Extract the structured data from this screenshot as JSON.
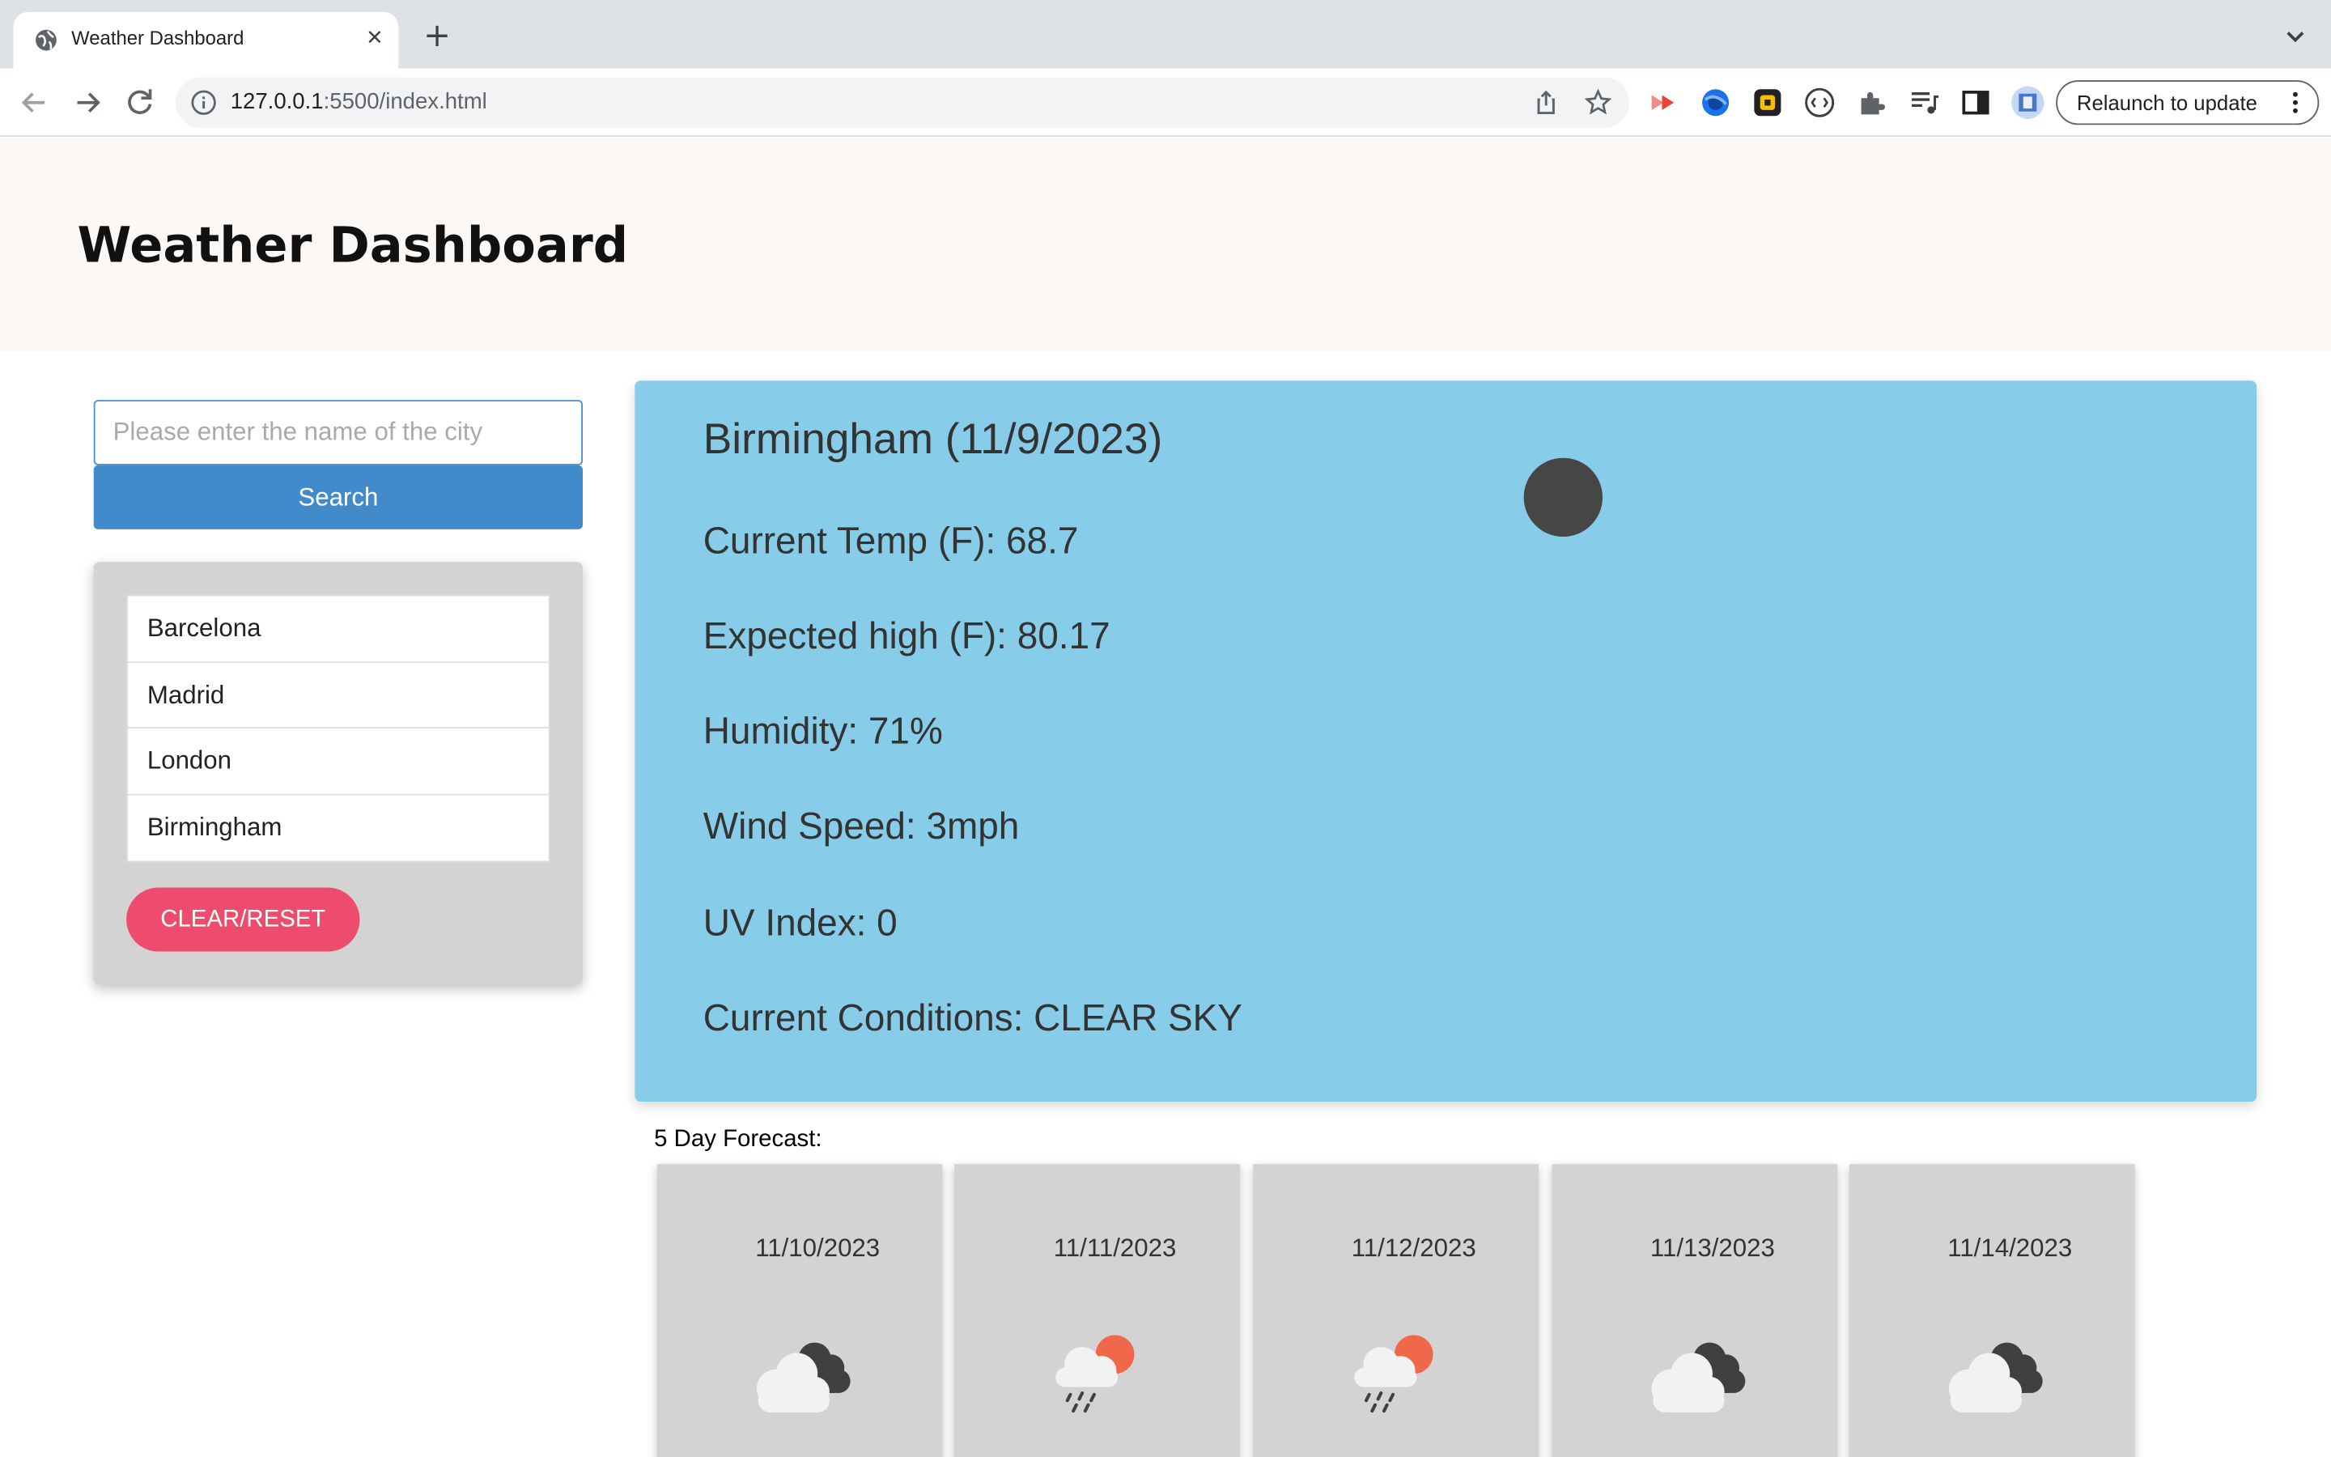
{
  "browser": {
    "tab_title": "Weather Dashboard",
    "url_host": "127.0.0.1",
    "url_rest": ":5500/index.html",
    "relaunch_label": "Relaunch to update"
  },
  "app": {
    "title": "Weather Dashboard"
  },
  "search": {
    "placeholder": "Please enter the name of the city",
    "value": "",
    "button_label": "Search"
  },
  "history": {
    "items": [
      "Barcelona",
      "Madrid",
      "London",
      "Birmingham"
    ],
    "clear_label": "CLEAR/RESET"
  },
  "current": {
    "title": "Birmingham (11/9/2023)",
    "temp": "Current Temp (F): 68.7",
    "high": "Expected high (F): 80.17",
    "humidity": "Humidity: 71%",
    "wind": "Wind Speed: 3mph",
    "uv": "UV Index: 0",
    "conditions": "Current Conditions: CLEAR SKY"
  },
  "forecast": {
    "label": "5 Day Forecast:",
    "days": [
      {
        "date": "11/10/2023",
        "icon": "cloudy-icon"
      },
      {
        "date": "11/11/2023",
        "icon": "sun-rain-icon"
      },
      {
        "date": "11/12/2023",
        "icon": "sun-rain-icon"
      },
      {
        "date": "11/13/2023",
        "icon": "cloudy-icon"
      },
      {
        "date": "11/14/2023",
        "icon": "cloudy-icon"
      }
    ]
  },
  "colors": {
    "header_bg": "#fcf8f6",
    "search_button": "#428bca",
    "clear_button": "#ee4c6e",
    "current_panel": "#87cce8",
    "card_bg": "#d3d3d3"
  }
}
